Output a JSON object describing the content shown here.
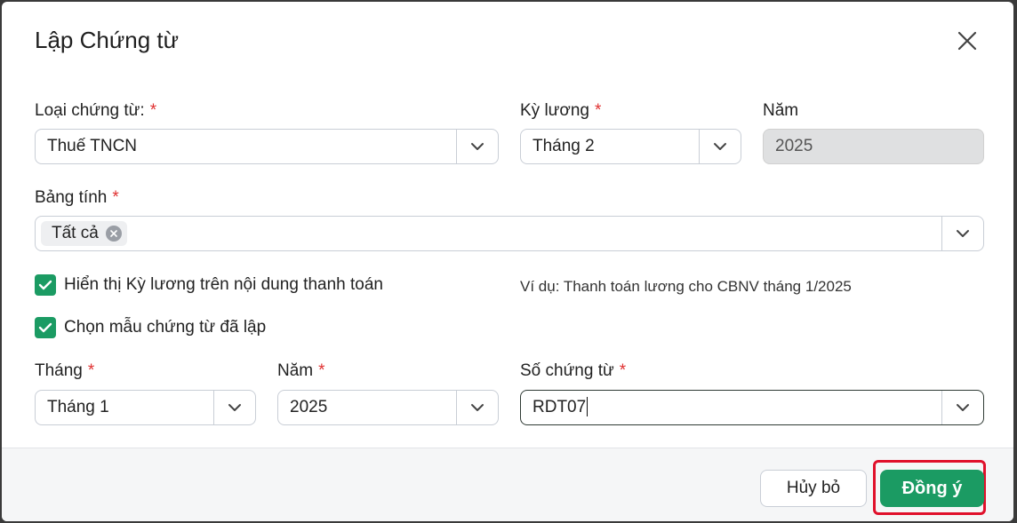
{
  "dialog": {
    "title": "Lập Chứng từ"
  },
  "fields": {
    "voucher_type": {
      "label": "Loại chứng từ:",
      "value": "Thuế TNCN"
    },
    "pay_period": {
      "label": "Kỳ lương",
      "value": "Tháng 2"
    },
    "year_top": {
      "label": "Năm",
      "value": "2025"
    },
    "spreadsheet": {
      "label": "Bảng tính",
      "tag": "Tất cả"
    },
    "month": {
      "label": "Tháng",
      "value": "Tháng 1"
    },
    "year": {
      "label": "Năm",
      "value": "2025"
    },
    "voucher_no": {
      "label": "Số chứng từ",
      "value": "RDT07"
    }
  },
  "required_mark": "*",
  "checkboxes": {
    "show_period": {
      "label": "Hiển thị Kỳ lương trên nội dung thanh toán",
      "checked": true
    },
    "use_template": {
      "label": "Chọn mẫu chứng từ đã lập",
      "checked": true
    }
  },
  "example_text": "Ví dụ: Thanh toán lương cho CBNV tháng 1/2025",
  "footer": {
    "cancel_label": "Hủy bỏ",
    "ok_label": "Đồng ý"
  },
  "colors": {
    "accent": "#1b9b63",
    "required": "#e03131",
    "highlight": "#e0102b"
  },
  "icons": {
    "close": "close-icon",
    "dropdown": "chevron-down-icon",
    "check": "check-icon",
    "remove": "remove-tag-icon"
  }
}
